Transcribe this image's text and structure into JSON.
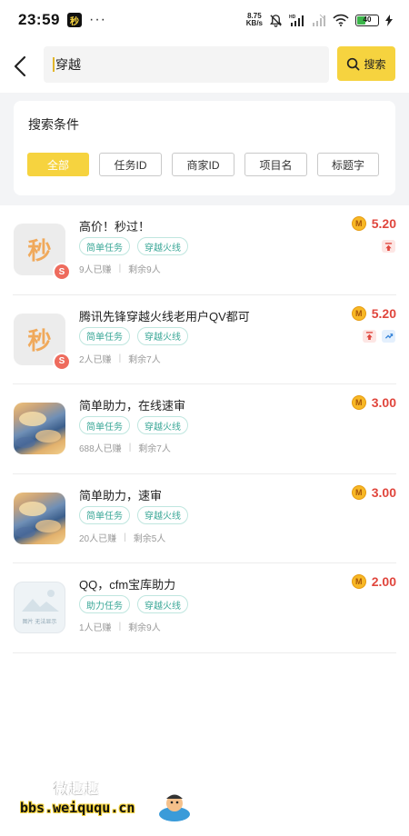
{
  "status_bar": {
    "time": "23:59",
    "app_badge": "秒",
    "more": "···",
    "net_speed_value": "8.75",
    "net_speed_unit": "KB/s",
    "battery": "40"
  },
  "search": {
    "back_icon": "chevron-left-icon",
    "value": "穿越",
    "button_label": "搜索",
    "button_color": "#f6d33f"
  },
  "filter": {
    "title": "搜索条件",
    "chips": [
      {
        "label": "全部",
        "active": true
      },
      {
        "label": "任务ID",
        "active": false
      },
      {
        "label": "商家ID",
        "active": false
      },
      {
        "label": "项目名",
        "active": false
      },
      {
        "label": "标题字",
        "active": false
      }
    ]
  },
  "tasks": [
    {
      "title": "高价！秒过！",
      "thumb": "miao",
      "thumb_text": "秒",
      "thumb_badge": "S",
      "tags": [
        "简单任务",
        "穿越火线"
      ],
      "earned": "9人已赚",
      "remaining": "剩余9人",
      "reward": "5.20",
      "flags": [
        "top"
      ]
    },
    {
      "title": "腾讯先锋穿越火线老用户QV都可",
      "thumb": "miao",
      "thumb_text": "秒",
      "thumb_badge": "S",
      "tags": [
        "简单任务",
        "穿越火线"
      ],
      "earned": "2人已赚",
      "remaining": "剩余7人",
      "reward": "5.20",
      "flags": [
        "top",
        "hot"
      ]
    },
    {
      "title": "简单助力，在线速审",
      "thumb": "sky",
      "tags": [
        "简单任务",
        "穿越火线"
      ],
      "earned": "688人已赚",
      "remaining": "剩余7人",
      "reward": "3.00",
      "flags": []
    },
    {
      "title": "简单助力，速审",
      "thumb": "sky",
      "tags": [
        "简单任务",
        "穿越火线"
      ],
      "earned": "20人已赚",
      "remaining": "剩余5人",
      "reward": "3.00",
      "flags": []
    },
    {
      "title": "QQ，cfm宝库助力",
      "thumb": "placeholder",
      "thumb_text": "图片 无法显示",
      "tags": [
        "助力任务",
        "穿越火线"
      ],
      "earned": "1人已赚",
      "remaining": "剩余9人",
      "reward": "2.00",
      "flags": []
    }
  ],
  "colors": {
    "accent": "#f6d33f",
    "reward": "#e0463d",
    "tag": "#3aa797"
  },
  "watermark": {
    "title": "微趣趣",
    "url": "bbs.weiququ.cn"
  }
}
